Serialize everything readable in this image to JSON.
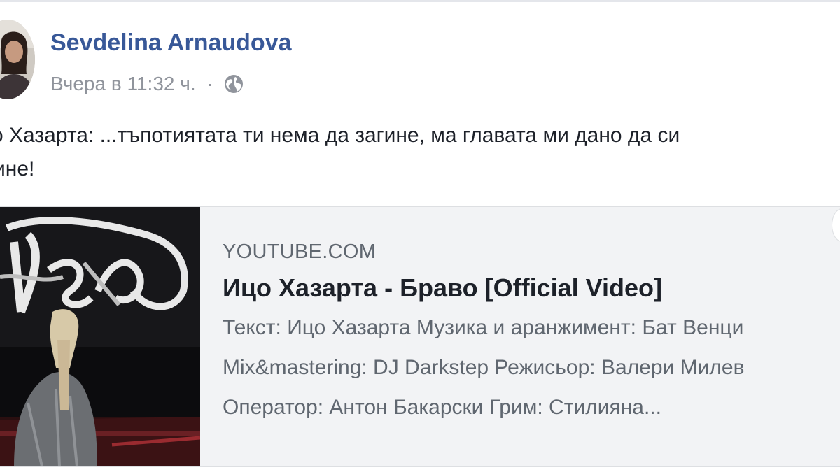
{
  "post": {
    "author": "Sevdelina Arnaudova",
    "timestamp": "Вчера в 11:32 ч.",
    "separator": "·",
    "audience_icon": "globe-icon",
    "text_lines": [
      "о Хазарта: ...тъпотиятата ти нема да загине, ма главата ми дано да си",
      "ине!"
    ]
  },
  "link_card": {
    "domain": "YOUTUBE.COM",
    "title": "Ицо Хазарта - Браво [Official Video]",
    "description_lines": [
      "Текст: Ицо Хазарта Музика и аранжимент: Бат Венци",
      "Mix&mastering: DJ Darkstep Режисьор: Валери Милев",
      "Оператор: Антон Бакарски Грим: Стилияна..."
    ],
    "thumbnail_icon": "video-thumbnail"
  },
  "colors": {
    "author_link": "#385898",
    "meta_text": "#90949c",
    "card_background": "#f2f3f5",
    "card_border": "#dddfe2"
  }
}
